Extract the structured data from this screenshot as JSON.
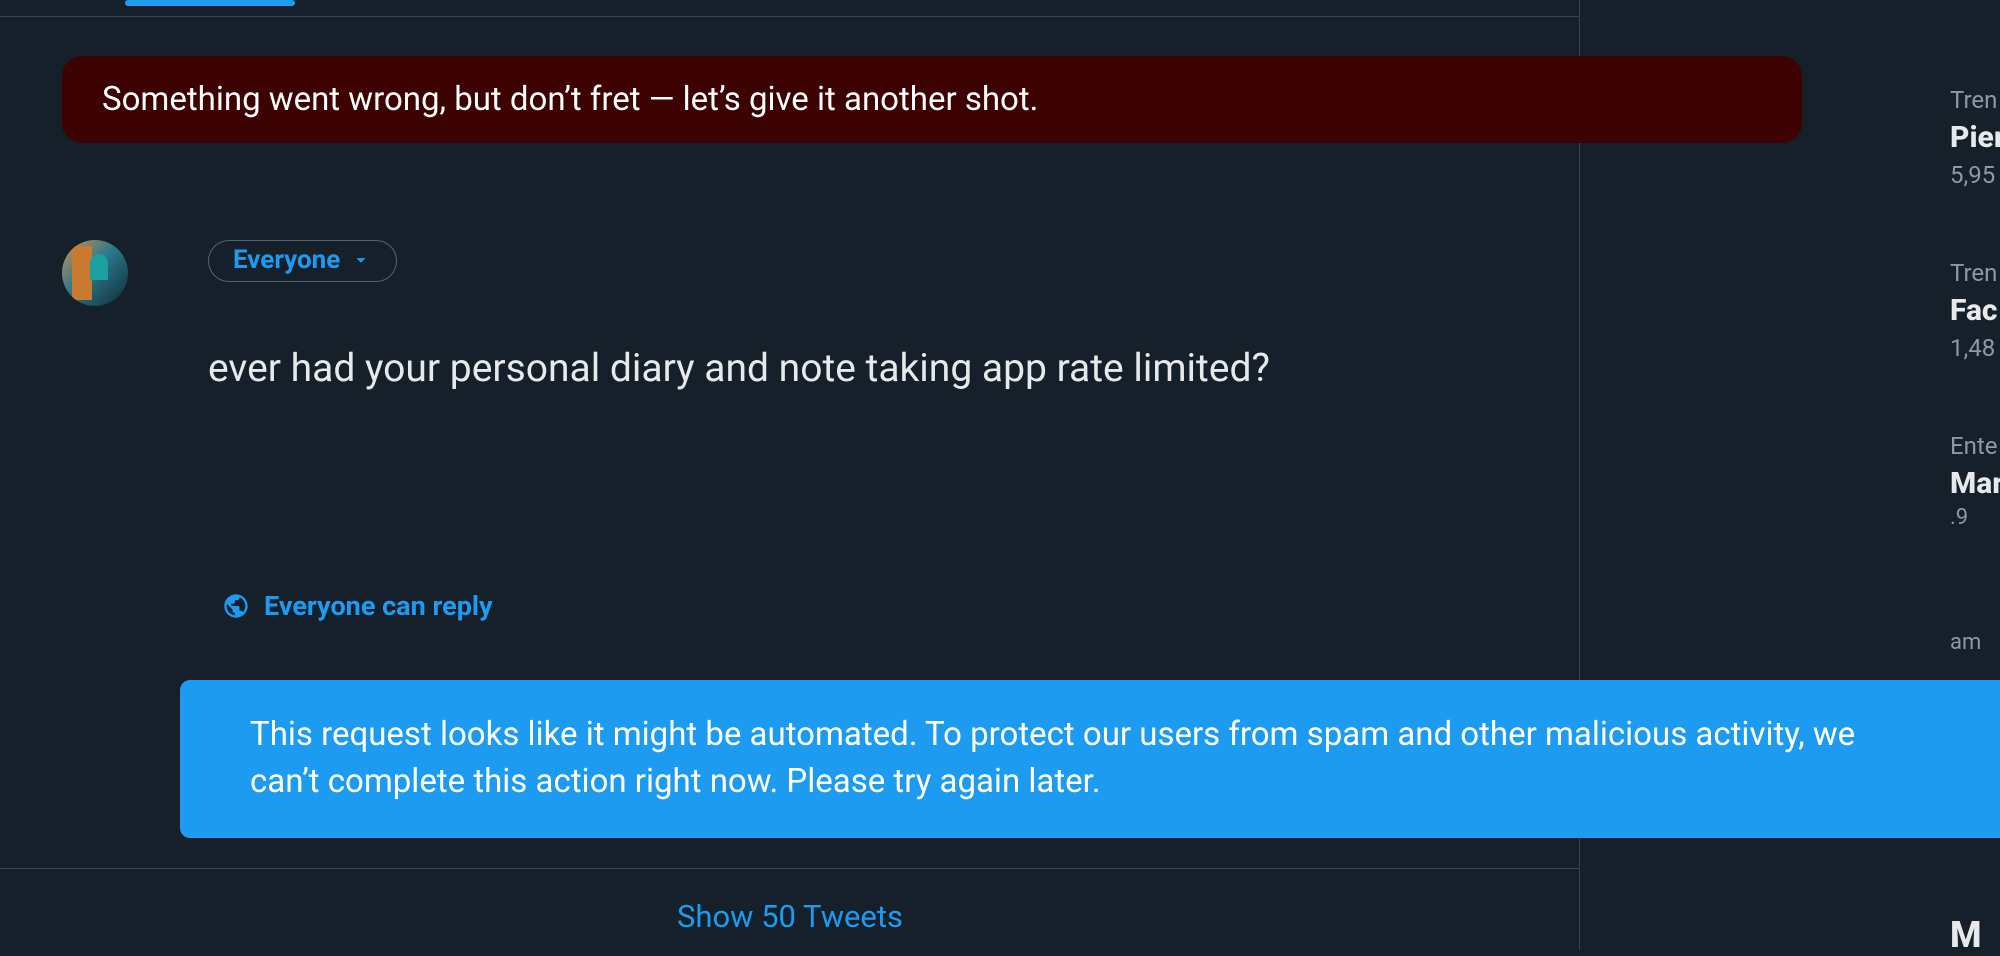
{
  "error_banner": {
    "text": "Something went wrong, but don’t fret — let’s give it another shot."
  },
  "compose": {
    "audience_label": "Everyone",
    "text": "ever had your personal diary and note taking app rate limited?",
    "reply_setting_label": "Everyone can reply"
  },
  "toast": {
    "text": "This request looks like it might be automated. To protect our users from spam and other malicious activity, we can’t complete this action right now. Please try again later."
  },
  "feed": {
    "show_more_label": "Show 50 Tweets"
  },
  "sidebar": {
    "trends": [
      {
        "meta": "Tren",
        "title": "Pier",
        "count": "5,95"
      },
      {
        "meta": "Tren",
        "title": "Fac",
        "count": "1,48"
      },
      {
        "meta": "Ente",
        "title": "Mar",
        "count": "",
        "sub1": ".9",
        "sub2": "am"
      }
    ],
    "partial_title": "M"
  }
}
